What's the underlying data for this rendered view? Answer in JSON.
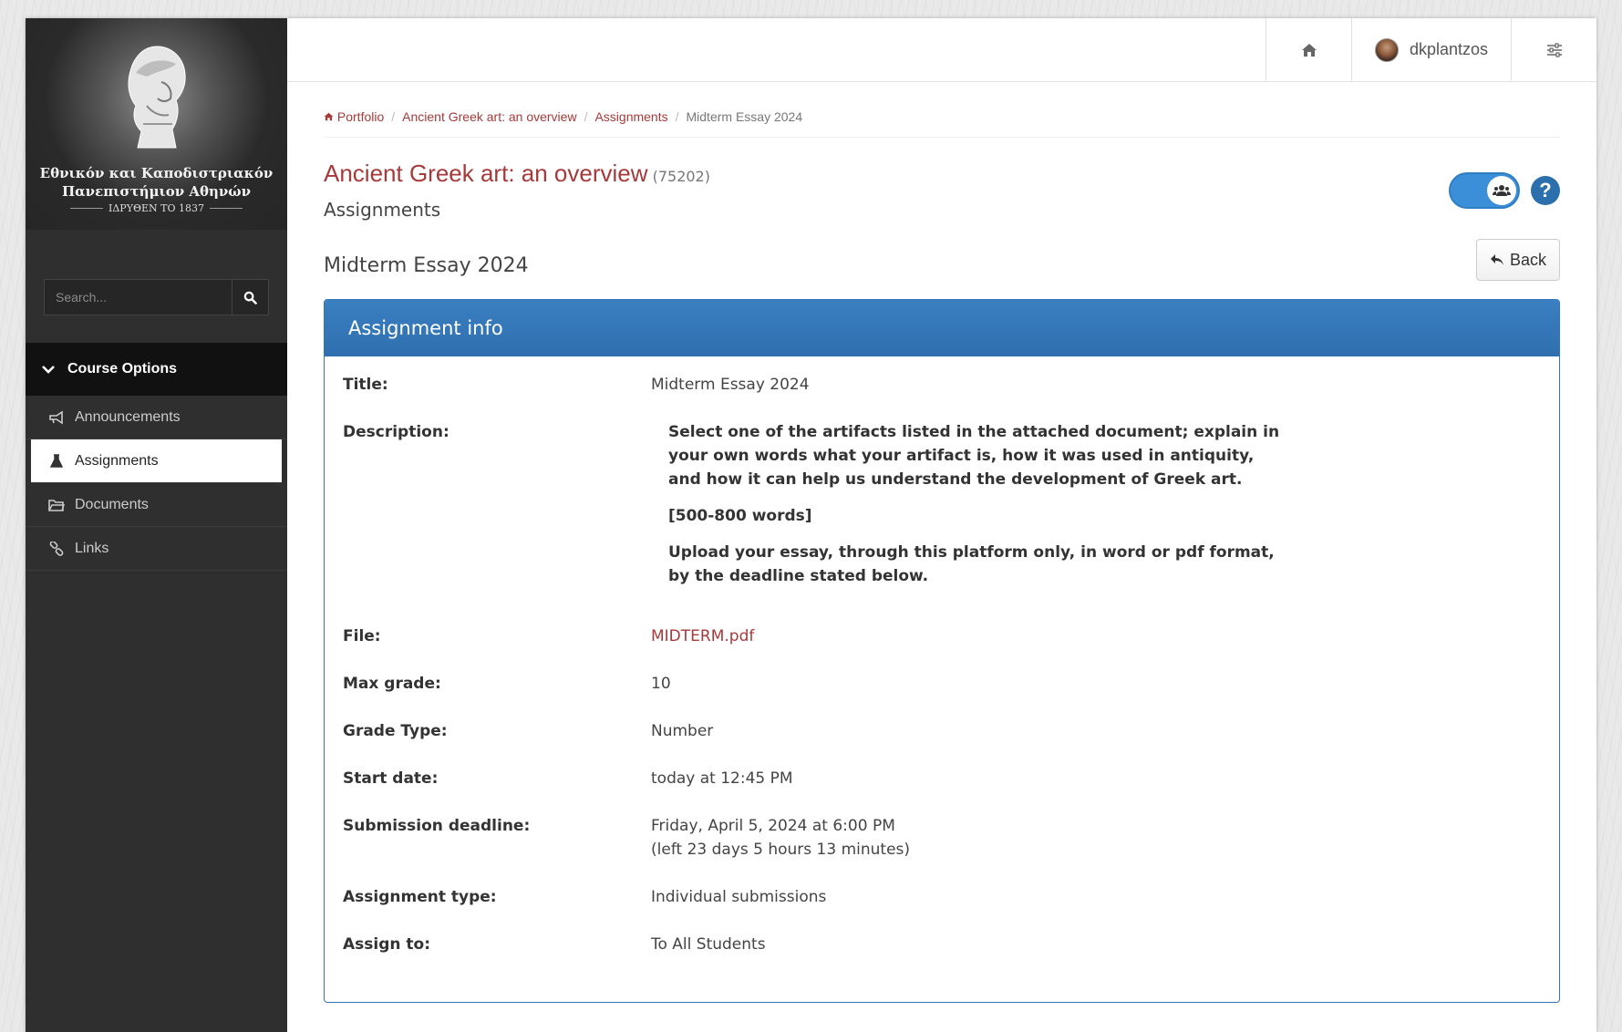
{
  "sidebar": {
    "university_line1": "Εθνικόν και Καποδιστριακόν",
    "university_line2": "Πανεπιστήμιον Αθηνών",
    "university_founded": "ΙΔΡΥΘΕΝ ΤΟ 1837",
    "search_placeholder": "Search...",
    "course_options_label": "Course Options",
    "items": [
      {
        "label": "Announcements",
        "icon": "megaphone-icon"
      },
      {
        "label": "Assignments",
        "icon": "flask-icon",
        "active": true
      },
      {
        "label": "Documents",
        "icon": "folder-icon"
      },
      {
        "label": "Links",
        "icon": "link-icon"
      }
    ]
  },
  "topbar": {
    "username": "dkplantzos"
  },
  "breadcrumb": {
    "items": [
      "Portfolio",
      "Ancient Greek art: an overview",
      "Assignments"
    ],
    "current": "Midterm Essay 2024"
  },
  "course": {
    "title": "Ancient Greek art: an overview",
    "code": "(75202)",
    "section": "Assignments"
  },
  "assignment": {
    "title": "Midterm Essay 2024",
    "back_label": "Back",
    "panel_title": "Assignment info",
    "labels": {
      "title": "Title:",
      "description": "Description:",
      "file": "File:",
      "max_grade": "Max grade:",
      "grade_type": "Grade Type:",
      "start_date": "Start date:",
      "deadline": "Submission deadline:",
      "type": "Assignment type:",
      "assign_to": "Assign to:"
    },
    "values": {
      "title": "Midterm Essay 2024",
      "description_p1": "Select one of the artifacts listed in the attached document; explain in your own words what your artifact is, how it was used in antiquity, and how it can help us understand the development of Greek art.",
      "description_p2": "[500-800 words]",
      "description_p3": "Upload your essay, through this platform only, in word or pdf format, by the deadline stated below.",
      "file": "MIDTERM.pdf",
      "max_grade": "10",
      "grade_type": "Number",
      "start_date": "today at 12:45 PM",
      "deadline": "Friday, April 5, 2024 at 6:00 PM",
      "deadline_left": "(left 23 days 5 hours 13 minutes)",
      "type": "Individual submissions",
      "assign_to": "To All Students"
    }
  },
  "colors": {
    "accent_red": "#a63a3a",
    "panel_blue": "#3377bb",
    "sidebar_bg": "#2f2f2f"
  }
}
